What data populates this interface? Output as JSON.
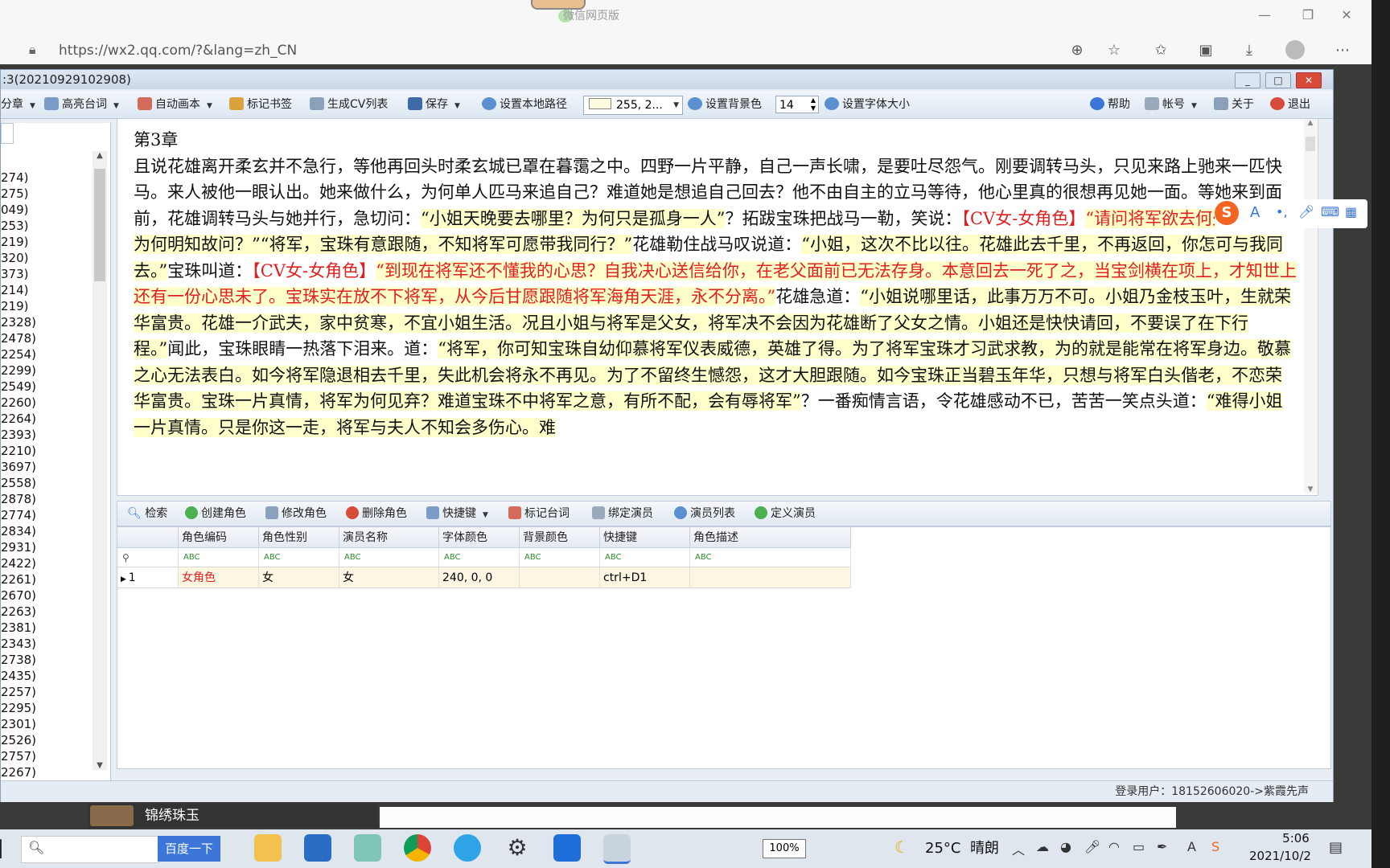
{
  "browser": {
    "top_title": "微信网页版",
    "url": "https://wx2.qq.com/?&lang=zh_CN"
  },
  "app": {
    "title": ":3(20210929102908)",
    "toolbar": {
      "item_chapter": "分章",
      "item_highlight": "高亮台词",
      "item_auto": "自动画本",
      "item_bookmark": "标记书签",
      "item_cvlist": "生成CV列表",
      "item_save": "保存",
      "item_localpath": "设置本地路径",
      "color_value": "255, 2...",
      "item_bgcolor": "设置背景色",
      "font_size": "14",
      "item_fontsize": "设置字体大小",
      "item_help": "帮助",
      "item_account": "帐号",
      "item_about": "关于",
      "item_exit": "退出"
    },
    "left_list": [
      "274)",
      "275)",
      "049)",
      "253)",
      "219)",
      "320)",
      "373)",
      "214)",
      "219)",
      "2328)",
      "2478)",
      "2254)",
      "2299)",
      "2549)",
      "2260)",
      "2264)",
      "2393)",
      "2210)",
      "3697)",
      "2558)",
      "2878)",
      "2774)",
      "2834)",
      "2931)",
      "2422)",
      "2261)",
      "2670)",
      "2263)",
      "2381)",
      "2343)",
      "2738)",
      "2435)",
      "2257)",
      "2295)",
      "2301)",
      "2526)",
      "2757)",
      "2267)"
    ],
    "editor": {
      "chapter": "第3章",
      "p1_plain": "且说花雄离开柔玄并不急行，等他再回头时柔玄城已罩在暮霭之中。四野一片平静，自己一声长啸，是要吐尽怨气。刚要调转马头，只见来路上驰来一匹快马。来人被他一眼认出。她来做什么，为何单人匹马来追自己？难道她是想追自己回去？他不由自主的立马等待，他心里真的很想再见她一面。等她来到面前，花雄调转马头与她并行，急切问：",
      "p1_hl": "“小姐天晚要去哪里？为何只是孤身一人”",
      "p1_tail": "？拓跋宝珠把战马一勒，笑说：",
      "tag1": "【CV女-女角色】",
      "q1": "“请问将军欲去何处？”",
      "hl2": "“小姐为何明知故问？”“将军，宝珠有意跟随，不知将军可愿带我同行？”",
      "mid2": "花雄勒住战马叹说道：",
      "hl3": "“小姐，这次不比以往。花雄此去千里，不再返回，你怎可与我同去。”",
      "mid3": "宝珠叫道：",
      "tag2": "【CV女-女角色】",
      "q2": "“到现在将军还不懂我的心思？自我决心送信给你，在老父面前已无法存身。本意回去一死了之，当宝剑横在项上，才知世上还有一份心思未了。宝珠实在放不下将军，从今后甘愿跟随将军海角天涯，永不分离。”",
      "mid4": "花雄急道：",
      "hl4": "“小姐说哪里话，此事万万不可。小姐乃金枝玉叶，生就荣华富贵。花雄一介武夫，家中贫寒，不宜小姐生活。况且小姐与将军是父女，将军决不会因为花雄断了父女之情。小姐还是快快请回，不要误了在下行程。”",
      "mid5": "闻此，宝珠眼睛一热落下泪来。道：",
      "hl5": "“将军，你可知宝珠自幼仰慕将军仪表威德，英雄了得。为了将军宝珠才习武求教，为的就是能常在将军身边。敬慕之心无法表白。如今将军隐退相去千里，失此机会将永不再见。为了不留终生憾怨，这才大胆跟随。如今宝珠正当碧玉年华，只想与将军白头偕老，不恋荣华富贵。宝珠一片真情，将军为何见弃？难道宝珠不中将军之意，有所不配，会有辱将军”",
      "mid6": "？一番痴情言语，令花雄感动不已，苦苦一笑点头道：",
      "hl6": "“难得小姐一片真情。只是你这一走，将军与夫人不知会多伤心。难"
    },
    "lower_toolbar": {
      "search": "检索",
      "create_role": "创建角色",
      "edit_role": "修改角色",
      "delete_role": "删除角色",
      "shortcut": "快捷键",
      "mark_line": "标记台词",
      "bind_actor": "绑定演员",
      "actor_list": "演员列表",
      "define_actor": "定义演员"
    },
    "grid": {
      "headers": [
        "角色编码",
        "角色性别",
        "演员名称",
        "字体颜色",
        "背景颜色",
        "快捷键",
        "角色描述"
      ],
      "filter_glyph": "ABC",
      "rows": [
        {
          "index": "1",
          "role": "女角色",
          "gender": "女",
          "actor": "女",
          "font_color": "240, 0, 0",
          "bg_color": "",
          "shortcut": "ctrl+D1",
          "desc": ""
        }
      ]
    },
    "status": "登录用户：18152606020->紫霞先声"
  },
  "media": {
    "title": "锦绣珠玉"
  },
  "taskbar": {
    "search_button": "百度一下",
    "battery": "100%",
    "temperature": "25°C",
    "weather": "晴朗",
    "time": "5:06",
    "date": "2021/10/2"
  },
  "colors": {
    "highlight": "#ffffcc",
    "red_text": "#e02020",
    "role_red": "#e02020",
    "accent": "#3b76d8"
  }
}
